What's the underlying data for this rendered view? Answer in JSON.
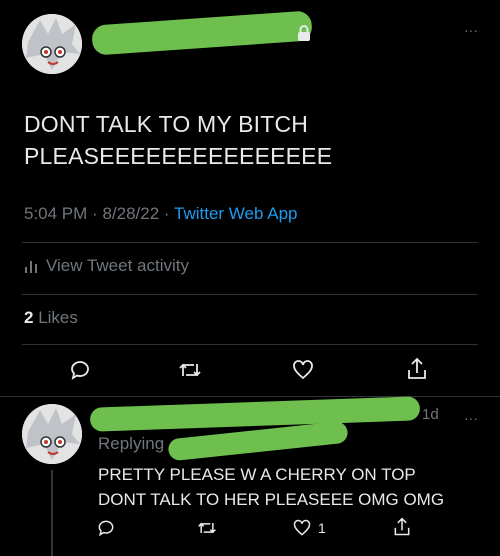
{
  "menu_dots": "···",
  "tweet": {
    "text_line1": "DONT TALK TO MY BITCH",
    "text_line2": "PLEASEEEEEEEEEEEEEEE",
    "time": "5:04 PM",
    "sep1": "·",
    "date": "8/28/22",
    "sep2": "·",
    "source": "Twitter Web App",
    "activity_label": "View Tweet activity",
    "likes_count": "2",
    "likes_label": "Likes"
  },
  "reply": {
    "timestamp": "1d",
    "replying_prefix": "Replying",
    "text_line1": "PRETTY PLEASE W A CHERRY ON TOP",
    "text_line2": "DONT TALK TO HER PLEASEEE OMG OMG",
    "like_count": "1"
  },
  "colors": {
    "accent": "#1d9bf0",
    "redaction": "#6ebf4e",
    "muted": "#71767b"
  }
}
